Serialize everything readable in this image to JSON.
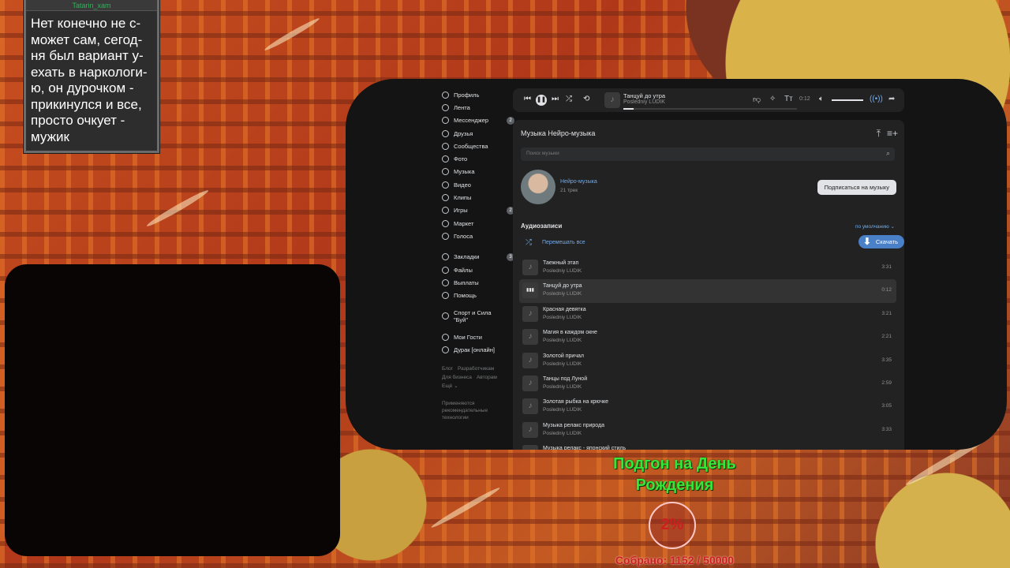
{
  "chat": {
    "username": "Tatarin_xam",
    "message": "Нет конечно не с-может сам, сегод-ня был вариант у-ехать в наркологи-ю, он дурочком - прикинулся и все, просто очкует - мужик"
  },
  "sidebar": {
    "items": [
      {
        "label": "Профиль",
        "icon": "user-icon"
      },
      {
        "label": "Лента",
        "icon": "feed-icon"
      },
      {
        "label": "Мессенджер",
        "icon": "chat-icon",
        "badge": "2"
      },
      {
        "label": "Друзья",
        "icon": "friends-icon"
      },
      {
        "label": "Сообщества",
        "icon": "groups-icon"
      },
      {
        "label": "Фото",
        "icon": "photo-icon"
      },
      {
        "label": "Музыка",
        "icon": "music-icon"
      },
      {
        "label": "Видео",
        "icon": "video-icon"
      },
      {
        "label": "Клипы",
        "icon": "clips-icon"
      },
      {
        "label": "Игры",
        "icon": "games-icon",
        "badge": "2"
      },
      {
        "label": "Маркет",
        "icon": "market-icon"
      },
      {
        "label": "Голоса",
        "icon": "votes-icon"
      }
    ],
    "items2": [
      {
        "label": "Закладки",
        "badge": "3"
      },
      {
        "label": "Файлы"
      },
      {
        "label": "Выплаты"
      },
      {
        "label": "Помощь"
      }
    ],
    "group": "Спорт и Сила \"Буй\"",
    "apps": [
      {
        "label": "Мои Гости"
      },
      {
        "label": "Дурак [онлайн]"
      }
    ],
    "footer": {
      "blog": "Блог",
      "dev": "Разработчикам",
      "biz": "Для бизнеса",
      "authors": "Авторам",
      "more": "Ещё ⌄",
      "note": "Применяются рекомендательные технологии"
    }
  },
  "player": {
    "title": "Танцуй до утра",
    "artist": "Posledniy LUDIK",
    "time": "0:12",
    "progress": 0.06,
    "volume": 1.0
  },
  "music": {
    "heading": "Музыка Нейро-музыка",
    "search_placeholder": "Поиск музыки",
    "artist_name": "Нейро-музыка",
    "artist_count": "21 трек",
    "subscribe_label": "Подписаться на музыку",
    "section_title": "Аудиозаписи",
    "sort_label": "по умолчанию ⌄",
    "shuffle_label": "Перемешать все",
    "download_label": "Скачать"
  },
  "tracks": [
    {
      "title": "Таежный этап",
      "artist": "Posledniy LUDIK",
      "duration": "3:31",
      "active": false
    },
    {
      "title": "Танцуй до утра",
      "artist": "Posledniy LUDIK",
      "duration": "0:12",
      "active": true
    },
    {
      "title": "Красная девятка",
      "artist": "Posledniy LUDIK",
      "duration": "3:21",
      "active": false
    },
    {
      "title": "Магия в каждом окне",
      "artist": "Posledniy LUDIK",
      "duration": "2:21",
      "active": false
    },
    {
      "title": "Золотой причал",
      "artist": "Posledniy LUDIK",
      "duration": "3:35",
      "active": false
    },
    {
      "title": "Танцы под Луной",
      "artist": "Posledniy LUDIK",
      "duration": "2:59",
      "active": false
    },
    {
      "title": "Золотая рыбка на крючке",
      "artist": "Posledniy LUDIK",
      "duration": "3:05",
      "active": false
    },
    {
      "title": "Музыка релакс природа",
      "artist": "Posledniy LUDIK",
      "duration": "3:33",
      "active": false
    },
    {
      "title": "Музыка релакс - японский стиль",
      "artist": "",
      "duration": "",
      "active": false
    }
  ],
  "goal": {
    "title": "Подгон на День Рождения",
    "percent": "2%",
    "collected": "Собрано: 1152 / 50000"
  }
}
